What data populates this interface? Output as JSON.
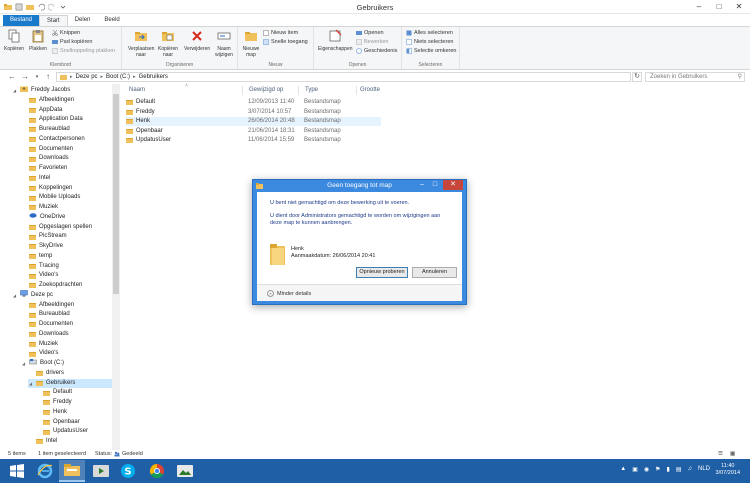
{
  "window": {
    "title": "Gebruikers"
  },
  "tabs": [
    {
      "label": "Bestand"
    },
    {
      "label": "Start"
    },
    {
      "label": "Delen"
    },
    {
      "label": "Beeld"
    }
  ],
  "ribbon": {
    "clipboard": {
      "label": "Klembord",
      "copy": "Kopiëren",
      "paste": "Plakken",
      "cut": "Knippen",
      "copy_path": "Pad kopiëren",
      "paste_shortcut": "Snelkoppeling plakken"
    },
    "organize": {
      "label": "Organiseren",
      "move_to": "Verplaatsen naar",
      "copy_to": "Kopiëren naar",
      "delete": "Verwijderen",
      "rename": "Naam wijzigen"
    },
    "new": {
      "label": "Nieuw",
      "new_folder": "Nieuwe map",
      "new_item": "Nieuw item",
      "easy_access": "Snelle toegang"
    },
    "open": {
      "label": "Openen",
      "properties": "Eigenschappen",
      "open": "Openen",
      "edit": "Bewerken",
      "history": "Geschiedenis"
    },
    "select": {
      "label": "Selecteren",
      "select_all": "Alles selecteren",
      "select_none": "Niets selecteren",
      "invert": "Selectie omkeren"
    }
  },
  "address": {
    "crumbs": [
      "Deze pc",
      "Boot (C:)",
      "Gebruikers"
    ],
    "search_placeholder": "Zoeken in Gebruikers"
  },
  "nav": {
    "items": [
      {
        "label": "Freddy Jacobs",
        "indent": 1,
        "icon": "user"
      },
      {
        "label": "Afbeeldingen",
        "indent": 2,
        "icon": "folder"
      },
      {
        "label": "AppData",
        "indent": 2,
        "icon": "folder"
      },
      {
        "label": "Application Data",
        "indent": 2,
        "icon": "folder"
      },
      {
        "label": "Bureaublad",
        "indent": 2,
        "icon": "folder"
      },
      {
        "label": "Contactpersonen",
        "indent": 2,
        "icon": "folder"
      },
      {
        "label": "Documenten",
        "indent": 2,
        "icon": "folder"
      },
      {
        "label": "Downloads",
        "indent": 2,
        "icon": "folder"
      },
      {
        "label": "Favorieten",
        "indent": 2,
        "icon": "folder"
      },
      {
        "label": "Intel",
        "indent": 2,
        "icon": "folder"
      },
      {
        "label": "Koppelingen",
        "indent": 2,
        "icon": "folder"
      },
      {
        "label": "Mobile Uploads",
        "indent": 2,
        "icon": "folder"
      },
      {
        "label": "Muziek",
        "indent": 2,
        "icon": "folder"
      },
      {
        "label": "OneDrive",
        "indent": 2,
        "icon": "cloud"
      },
      {
        "label": "Opgeslagen spellen",
        "indent": 2,
        "icon": "folder"
      },
      {
        "label": "PicStream",
        "indent": 2,
        "icon": "folder"
      },
      {
        "label": "SkyDrive",
        "indent": 2,
        "icon": "folder"
      },
      {
        "label": "temp",
        "indent": 2,
        "icon": "folder"
      },
      {
        "label": "Tracing",
        "indent": 2,
        "icon": "folder"
      },
      {
        "label": "Video's",
        "indent": 2,
        "icon": "folder"
      },
      {
        "label": "Zoekopdrachten",
        "indent": 2,
        "icon": "folder"
      },
      {
        "label": "Deze pc",
        "indent": 1,
        "icon": "pc"
      },
      {
        "label": "Afbeeldingen",
        "indent": 2,
        "icon": "folder"
      },
      {
        "label": "Bureaublad",
        "indent": 2,
        "icon": "folder"
      },
      {
        "label": "Documenten",
        "indent": 2,
        "icon": "folder"
      },
      {
        "label": "Downloads",
        "indent": 2,
        "icon": "folder"
      },
      {
        "label": "Muziek",
        "indent": 2,
        "icon": "folder"
      },
      {
        "label": "Video's",
        "indent": 2,
        "icon": "folder"
      },
      {
        "label": "Boot (C:)",
        "indent": 2,
        "icon": "drive"
      },
      {
        "label": "drivers",
        "indent": 3,
        "icon": "folder"
      },
      {
        "label": "Gebruikers",
        "indent": 3,
        "icon": "folder",
        "selected": true
      },
      {
        "label": "Default",
        "indent": 4,
        "icon": "folder"
      },
      {
        "label": "Freddy",
        "indent": 4,
        "icon": "folder"
      },
      {
        "label": "Henk",
        "indent": 4,
        "icon": "folder"
      },
      {
        "label": "Openbaar",
        "indent": 4,
        "icon": "folder"
      },
      {
        "label": "UpdatusUser",
        "indent": 4,
        "icon": "folder"
      },
      {
        "label": "Intel",
        "indent": 3,
        "icon": "folder"
      }
    ]
  },
  "columns": {
    "name": "Naam",
    "date": "Gewijzigd op",
    "type": "Type",
    "size": "Grootte"
  },
  "files": [
    {
      "name": "Default",
      "date": "12/09/2013 11:40",
      "type": "Bestandsmap"
    },
    {
      "name": "Freddy",
      "date": "3/07/2014 10:57",
      "type": "Bestandsmap"
    },
    {
      "name": "Henk",
      "date": "26/06/2014 20:48",
      "type": "Bestandsmap"
    },
    {
      "name": "Openbaar",
      "date": "21/06/2014 18:31",
      "type": "Bestandsmap"
    },
    {
      "name": "UpdatusUser",
      "date": "11/06/2014 15:59",
      "type": "Bestandsmap"
    }
  ],
  "status": {
    "count": "5 items",
    "selected": "1 item geselecteerd",
    "status_label": "Status:",
    "status_value": "Gedeeld"
  },
  "dialog": {
    "title": "Geen toegang tot map",
    "line1": "U bent niet gemachtigd om deze bewerking uit te voeren.",
    "line2a": "U dient door Administrators gemachtigd te worden om wijzigingen aan",
    "line2b": "deze map te kunnen aanbrengen.",
    "item_name": "Henk",
    "item_date": "Aanmaakdatum: 26/06/2014 20:41",
    "retry_button": "Opnieuw proberen",
    "cancel_button": "Annuleren",
    "less_details": "Minder details"
  },
  "taskbar": {
    "language": "NLD",
    "time": "11:40",
    "date": "3/07/2014"
  },
  "colors": {
    "accent": "#1979ca",
    "taskbar": "#1f5fa6",
    "dialog_frame": "#3c89e0",
    "close": "#c7463b"
  }
}
